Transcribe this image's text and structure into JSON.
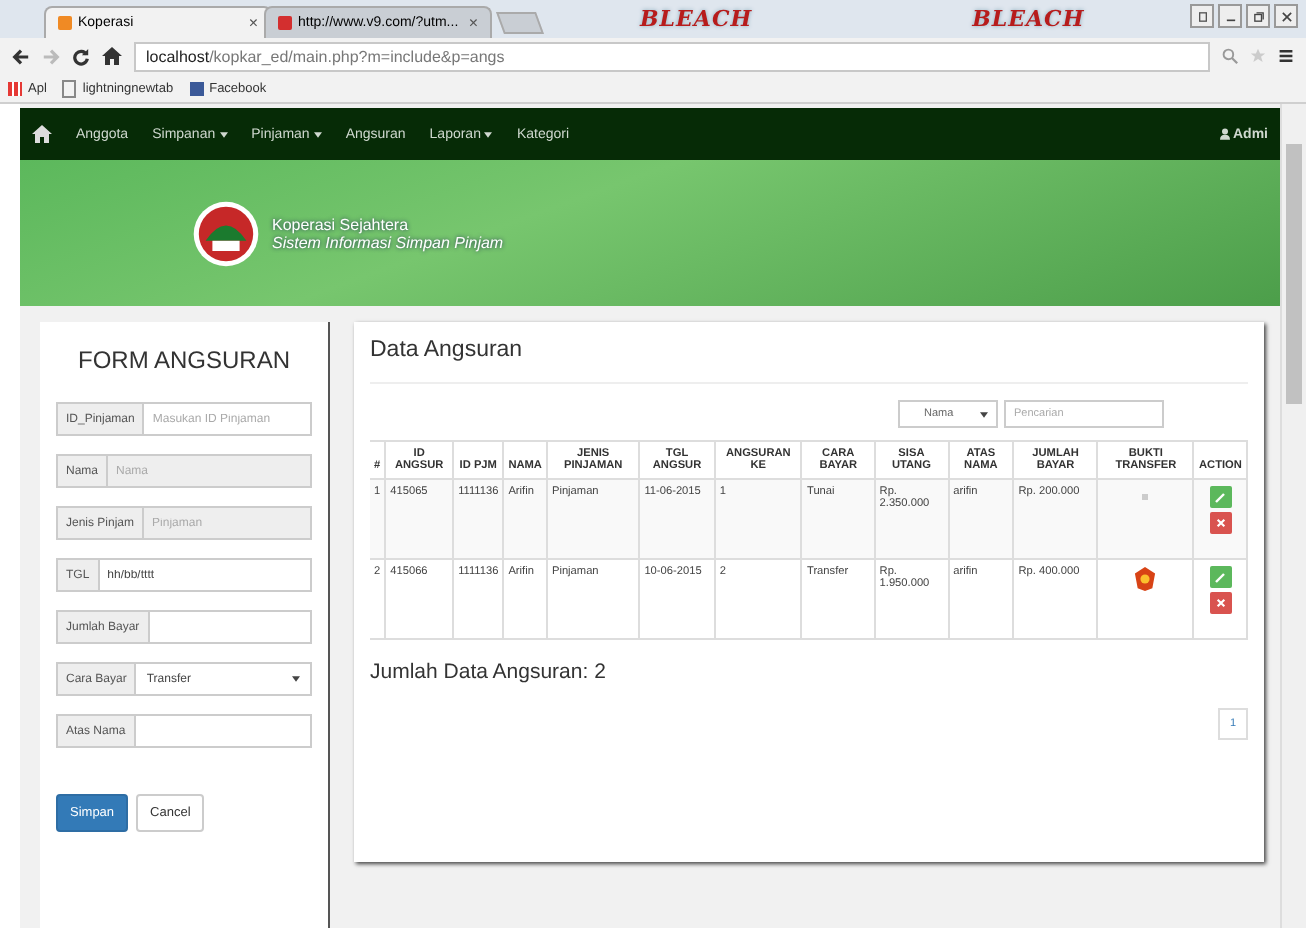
{
  "browser": {
    "tabs": [
      {
        "title": "Koperasi",
        "selected": true,
        "close": "×"
      },
      {
        "title": "http://www.v9.com/?utm...",
        "selected": false,
        "close": "×"
      }
    ],
    "theme_logos": [
      "BLEACH",
      "BLEACH"
    ],
    "address": {
      "host": "localhost",
      "path": "/kopkar_ed/main.php?m=include&p=angs"
    },
    "bookmarks": [
      {
        "kind": "apps",
        "label": "Apl"
      },
      {
        "kind": "page",
        "label": "lightningnewtab"
      },
      {
        "kind": "facebook",
        "label": "Facebook"
      }
    ]
  },
  "navbar": {
    "items": [
      {
        "label": "Anggota",
        "dropdown": false
      },
      {
        "label": "Simpanan",
        "dropdown": true
      },
      {
        "label": "Pinjaman",
        "dropdown": true
      },
      {
        "label": "Angsuran",
        "dropdown": false
      },
      {
        "label": "Laporan",
        "dropdown": true
      },
      {
        "label": "Kategori",
        "dropdown": false
      }
    ],
    "user": "Admi"
  },
  "banner": {
    "title": "Koperasi Sejahtera",
    "subtitle": "Sistem Informasi Simpan Pinjam"
  },
  "form": {
    "title": "FORM ANGSURAN",
    "fields": [
      {
        "kind": "input",
        "label": "ID_Pinjaman",
        "placeholder": "Masukan ID Pinjaman",
        "disabled": false
      },
      {
        "kind": "input",
        "label": "Nama",
        "placeholder": "Nama",
        "disabled": true
      },
      {
        "kind": "input",
        "label": "Jenis Pinjam",
        "placeholder": "Pinjaman",
        "disabled": true
      },
      {
        "kind": "input",
        "label": "TGL",
        "value": "hh/bb/tttt",
        "disabled": false
      },
      {
        "kind": "input",
        "label": "Jumlah Bayar",
        "disabled": false
      },
      {
        "kind": "select",
        "label": "Cara Bayar",
        "value": "Transfer",
        "disabled": false
      },
      {
        "kind": "input",
        "label": "Atas Nama",
        "disabled": false
      }
    ],
    "buttons": [
      {
        "label": "Simpan",
        "kind": "primary"
      },
      {
        "label": "Cancel",
        "kind": "default"
      }
    ]
  },
  "data": {
    "title": "Data Angsuran",
    "filter": {
      "value": "Nama"
    },
    "search": {
      "placeholder": "Pencarian"
    },
    "table": {
      "columns": [
        "#",
        "ID ANGSUR",
        "ID PJM",
        "NAMA",
        "JENIS PINJAMAN",
        "TGL ANGSUR",
        "ANGSURAN KE",
        "CARA BAYAR",
        "SISA UTANG",
        "ATAS NAMA",
        "JUMLAH BAYAR",
        "BUKTI TRANSFER",
        "ACTION"
      ],
      "rows": [
        {
          "cells": [
            "1",
            "415065",
            "1111136",
            "Arifin",
            "Pinjaman",
            "11-06-2015",
            "1",
            "Tunai",
            "Rp. 2.350.000",
            "arifin",
            "Rp. 200.000"
          ],
          "proof_image": false
        },
        {
          "cells": [
            "2",
            "415066",
            "1111136",
            "Arifin",
            "Pinjaman",
            "10-06-2015",
            "2",
            "Transfer",
            "Rp. 1.950.000",
            "arifin",
            "Rp. 400.000"
          ],
          "proof_image": true
        }
      ]
    },
    "total": "Jumlah Data Angsuran: 2",
    "pages": [
      {
        "label": "1",
        "selected": false
      }
    ]
  }
}
